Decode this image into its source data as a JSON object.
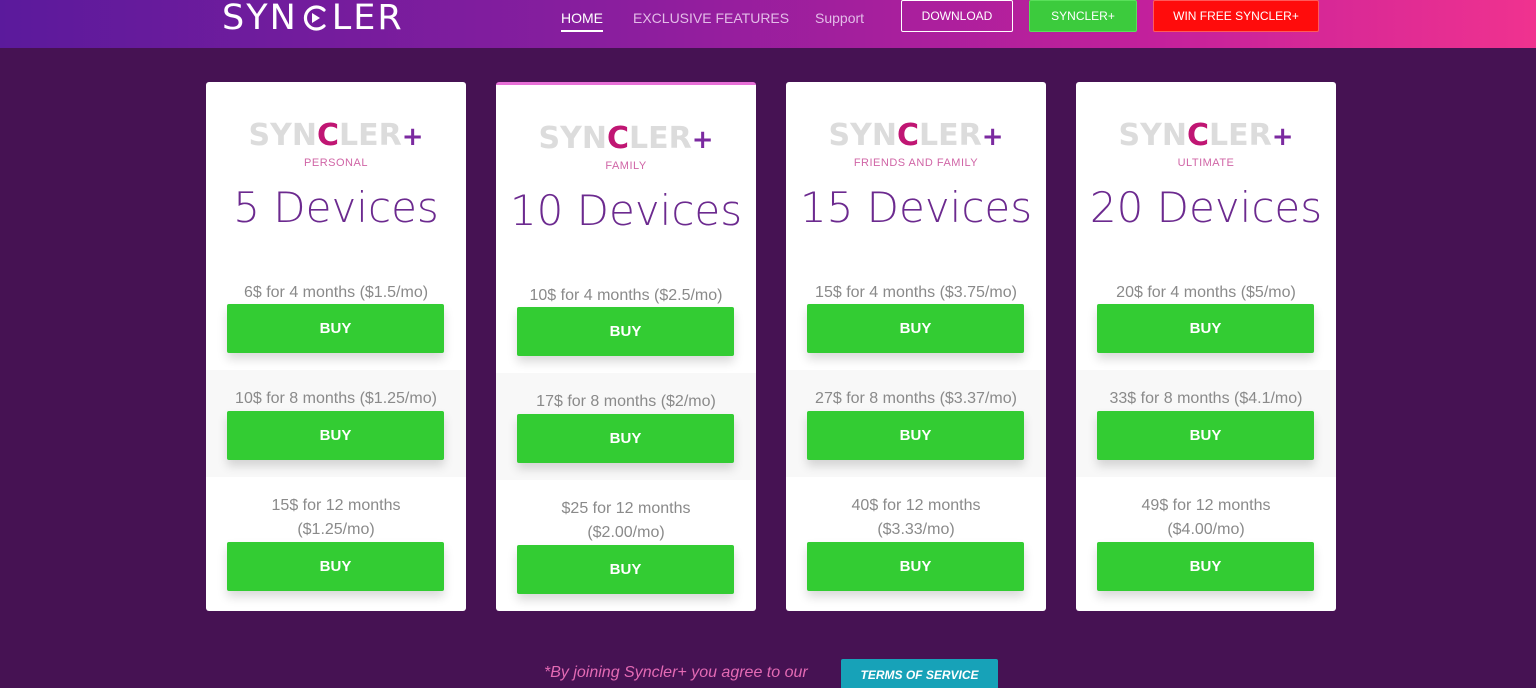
{
  "header": {
    "logo_parts": [
      "SYN",
      "LER"
    ],
    "nav": [
      "HOME",
      "EXCLUSIVE FEATURES",
      "Support"
    ],
    "buttons": {
      "download": "DOWNLOAD",
      "syncler_plus": "SYNCLER+",
      "win": "WIN FREE SYNCLER+"
    }
  },
  "brand": {
    "parts": [
      "SYN",
      "C",
      "LER",
      "+"
    ]
  },
  "plans": [
    {
      "tier": "PERSONAL",
      "devices": "5 Devices",
      "options": [
        {
          "price": "6$ for 4 months ($1.5/mo)",
          "buy": "BUY"
        },
        {
          "price": "10$ for 8 months ($1.25/mo)",
          "buy": "BUY"
        },
        {
          "price_line1": "15$ for 12 months",
          "price_line2": "($1.25/mo)",
          "buy": "BUY"
        }
      ]
    },
    {
      "tier": "FAMILY",
      "devices": "10 Devices",
      "options": [
        {
          "price": "10$ for 4 months ($2.5/mo)",
          "buy": "BUY"
        },
        {
          "price": "17$ for 8 months ($2/mo)",
          "buy": "BUY"
        },
        {
          "price_line1": "$25 for 12 months",
          "price_line2": "($2.00/mo)",
          "buy": "BUY"
        }
      ]
    },
    {
      "tier": "FRIENDS AND FAMILY",
      "devices": "15 Devices",
      "options": [
        {
          "price": "15$ for 4 months ($3.75/mo)",
          "buy": "BUY"
        },
        {
          "price": "27$ for 8 months ($3.37/mo)",
          "buy": "BUY"
        },
        {
          "price_line1": "40$ for 12 months",
          "price_line2": "($3.33/mo)",
          "buy": "BUY"
        }
      ]
    },
    {
      "tier": "ULTIMATE",
      "devices": "20 Devices",
      "options": [
        {
          "price": "20$ for 4 months ($5/mo)",
          "buy": "BUY"
        },
        {
          "price": "33$ for 8 months ($4.1/mo)",
          "buy": "BUY"
        },
        {
          "price_line1": "49$ for 12 months",
          "price_line2": "($4.00/mo)",
          "buy": "BUY"
        }
      ]
    }
  ],
  "footer": {
    "note": "*By joining Syncler+ you agree to our",
    "tos": "TERMS OF SERVICE"
  },
  "colors": {
    "background": "#461253",
    "buy_green": "#33cc33",
    "devices_purple": "#6c2a8f",
    "tier_pink": "#d065a6",
    "tos_teal": "#17a2b8",
    "win_red": "#ff0c0c"
  }
}
